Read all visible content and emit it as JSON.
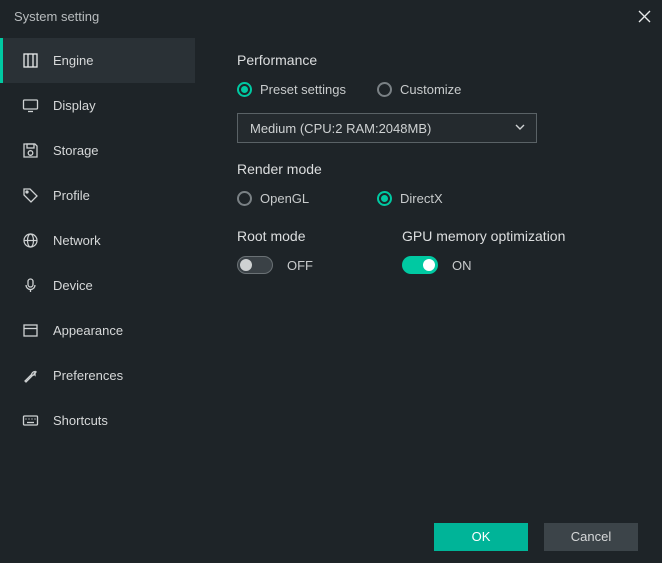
{
  "title": "System setting",
  "sidebar": {
    "items": [
      {
        "label": "Engine"
      },
      {
        "label": "Display"
      },
      {
        "label": "Storage"
      },
      {
        "label": "Profile"
      },
      {
        "label": "Network"
      },
      {
        "label": "Device"
      },
      {
        "label": "Appearance"
      },
      {
        "label": "Preferences"
      },
      {
        "label": "Shortcuts"
      }
    ]
  },
  "performance": {
    "heading": "Performance",
    "preset_label": "Preset settings",
    "customize_label": "Customize",
    "dropdown_value": "Medium (CPU:2 RAM:2048MB)"
  },
  "render": {
    "heading": "Render mode",
    "opengl_label": "OpenGL",
    "directx_label": "DirectX"
  },
  "root": {
    "heading": "Root mode",
    "state": "OFF"
  },
  "gpu": {
    "heading": "GPU memory optimization",
    "state": "ON"
  },
  "buttons": {
    "ok": "OK",
    "cancel": "Cancel"
  }
}
